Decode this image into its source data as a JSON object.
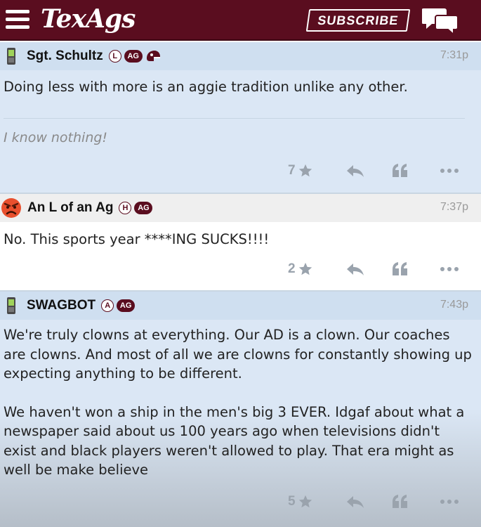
{
  "header": {
    "logo": "TexAgs",
    "subscribe_label": "SUBSCRIBE"
  },
  "colors": {
    "brand": "#5a0d1f",
    "post_bg": "#dbe7f5",
    "post_header_bg": "#cfdff0",
    "white_post_header_bg": "#efefef"
  },
  "posts": [
    {
      "handle": "Sgt. Schultz",
      "avatar": "phone-icon",
      "badges": [
        "L",
        "AG",
        "helmet"
      ],
      "time": "7:31p",
      "body": "Doing less with more is an aggie tradition unlike any other.",
      "signature": "I know nothing!",
      "stars": "7"
    },
    {
      "handle": "An L of an Ag",
      "avatar": "angry-face-icon",
      "badges": [
        "H",
        "AG"
      ],
      "time": "7:37p",
      "body": "No. This sports year ****ING SUCKS!!!!",
      "stars": "2"
    },
    {
      "handle": "SWAGBOT",
      "avatar": "phone-icon",
      "badges": [
        "A",
        "AG"
      ],
      "time": "7:43p",
      "body_p1": "We're truly clowns at everything. Our AD is a clown. Our coaches are clowns. And most of all we are clowns for constantly showing up expecting anything to be different.",
      "body_p2": "We haven't won a ship in the men's big 3 EVER. Idgaf about what a newspaper said about us 100 years ago when televisions didn't exist and black players weren't allowed to play. That era might as well be make believe",
      "stars": "5"
    }
  ]
}
